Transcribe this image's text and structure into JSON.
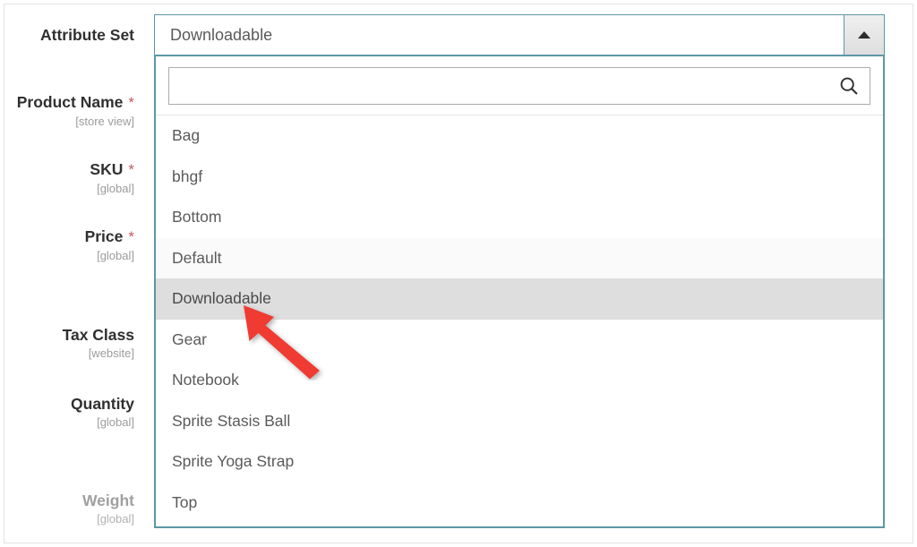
{
  "form": {
    "fields": [
      {
        "label": "Attribute Set",
        "scope": "",
        "required": false,
        "disabled": false
      },
      {
        "label": "Product Name",
        "scope": "[store view]",
        "required": true,
        "disabled": false
      },
      {
        "label": "SKU",
        "scope": "[global]",
        "required": true,
        "disabled": false
      },
      {
        "label": "Price",
        "scope": "[global]",
        "required": true,
        "disabled": false
      },
      {
        "label": "Tax Class",
        "scope": "[website]",
        "required": false,
        "disabled": false
      },
      {
        "label": "Quantity",
        "scope": "[global]",
        "required": false,
        "disabled": false
      },
      {
        "label": "Weight",
        "scope": "[global]",
        "required": false,
        "disabled": true
      }
    ],
    "required_marker": "*"
  },
  "attribute_set_select": {
    "selected_value": "Downloadable",
    "expanded": true,
    "toggle_icon": "caret-up-icon",
    "search": {
      "value": "",
      "placeholder": "",
      "icon": "search-icon"
    },
    "options": [
      "Bag",
      "bhgf",
      "Bottom",
      "Default",
      "Downloadable",
      "Gear",
      "Notebook",
      "Sprite Stasis Ball",
      "Sprite Yoga Strap",
      "Top"
    ],
    "highlighted_option": "Downloadable",
    "zebra_option": "Default"
  },
  "annotation": {
    "type": "arrow-pointer",
    "points_to": "Downloadable",
    "color": "#ef3b33"
  },
  "colors": {
    "accent_border": "#5d96a5",
    "required_asterisk": "#c4595f",
    "label_text": "#303030",
    "scope_text": "#9b9b9b",
    "option_text": "#5a5a5a",
    "highlight_bg": "#dedede",
    "zebra_bg": "#fafafa",
    "annotation_red": "#ef3b33"
  }
}
